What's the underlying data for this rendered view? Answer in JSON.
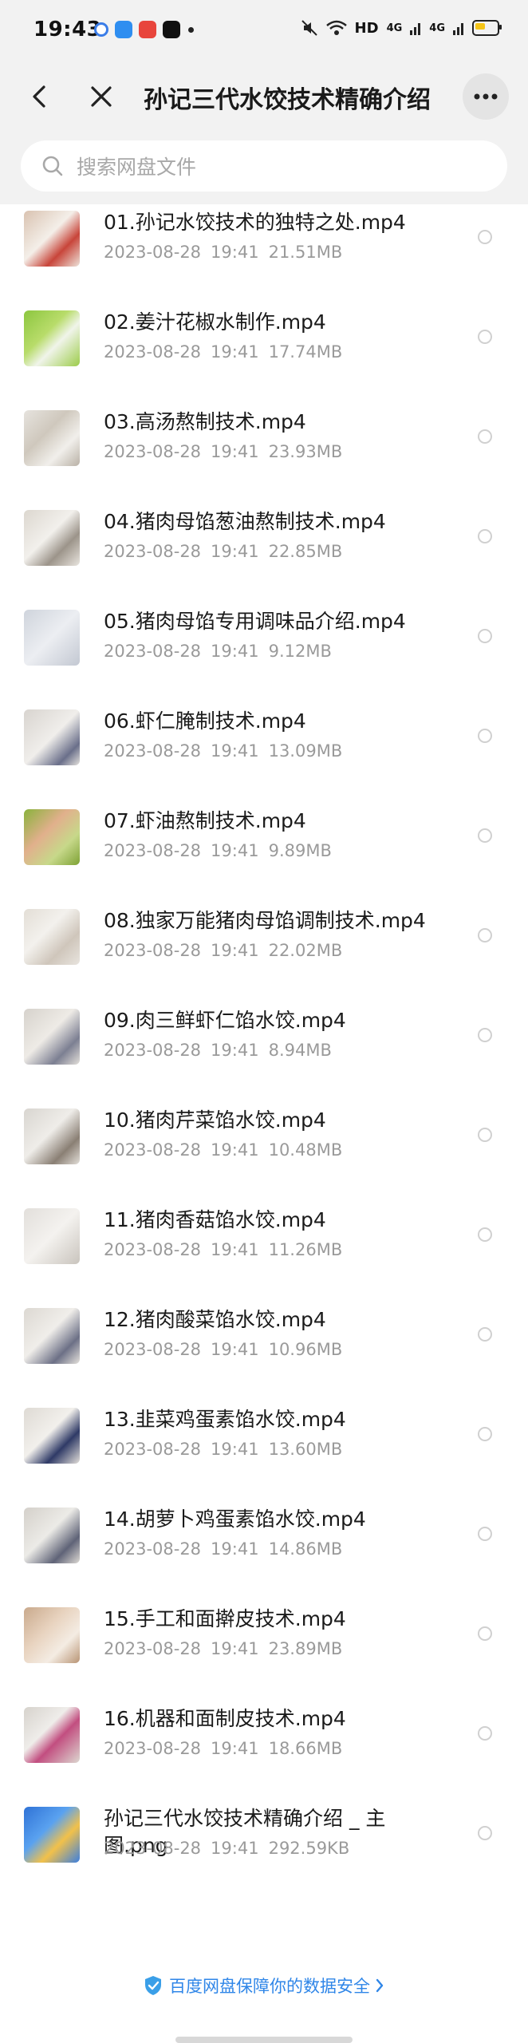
{
  "status_bar": {
    "time": "19:43",
    "network_label": "HD",
    "signal_1": "4G",
    "signal_2": "4G"
  },
  "nav": {
    "title": "孙记三代水饺技术精确介绍"
  },
  "search": {
    "placeholder": "搜索网盘文件"
  },
  "files": [
    {
      "name": "01.孙记水饺技术的独特之处.mp4",
      "date": "2023-08-28",
      "time": "19:41",
      "size": "21.51MB"
    },
    {
      "name": "02.姜汁花椒水制作.mp4",
      "date": "2023-08-28",
      "time": "19:41",
      "size": "17.74MB"
    },
    {
      "name": "03.高汤熬制技术.mp4",
      "date": "2023-08-28",
      "time": "19:41",
      "size": "23.93MB"
    },
    {
      "name": "04.猪肉母馅葱油熬制技术.mp4",
      "date": "2023-08-28",
      "time": "19:41",
      "size": "22.85MB"
    },
    {
      "name": "05.猪肉母馅专用调味品介绍.mp4",
      "date": "2023-08-28",
      "time": "19:41",
      "size": "9.12MB"
    },
    {
      "name": "06.虾仁腌制技术.mp4",
      "date": "2023-08-28",
      "time": "19:41",
      "size": "13.09MB"
    },
    {
      "name": "07.虾油熬制技术.mp4",
      "date": "2023-08-28",
      "time": "19:41",
      "size": "9.89MB"
    },
    {
      "name": "08.独家万能猪肉母馅调制技术.mp4",
      "date": "2023-08-28",
      "time": "19:41",
      "size": "22.02MB"
    },
    {
      "name": "09.肉三鲜虾仁馅水饺.mp4",
      "date": "2023-08-28",
      "time": "19:41",
      "size": "8.94MB"
    },
    {
      "name": "10.猪肉芹菜馅水饺.mp4",
      "date": "2023-08-28",
      "time": "19:41",
      "size": "10.48MB"
    },
    {
      "name": "11.猪肉香菇馅水饺.mp4",
      "date": "2023-08-28",
      "time": "19:41",
      "size": "11.26MB"
    },
    {
      "name": "12.猪肉酸菜馅水饺.mp4",
      "date": "2023-08-28",
      "time": "19:41",
      "size": "10.96MB"
    },
    {
      "name": "13.韭菜鸡蛋素馅水饺.mp4",
      "date": "2023-08-28",
      "time": "19:41",
      "size": "13.60MB"
    },
    {
      "name": "14.胡萝卜鸡蛋素馅水饺.mp4",
      "date": "2023-08-28",
      "time": "19:41",
      "size": "14.86MB"
    },
    {
      "name": "15.手工和面擀皮技术.mp4",
      "date": "2023-08-28",
      "time": "19:41",
      "size": "23.89MB"
    },
    {
      "name": "16.机器和面制皮技术.mp4",
      "date": "2023-08-28",
      "time": "19:41",
      "size": "18.66MB"
    },
    {
      "name": "孙记三代水饺技术精确介绍 _ 主图.png",
      "date": "2023-08-28",
      "time": "19:41",
      "size": "292.59KB"
    }
  ],
  "footer": {
    "text": "百度网盘保障你的数据安全"
  },
  "colors": {
    "accent": "#2f86e8",
    "background_header": "#f2f2f2",
    "meta_text": "#9a9a9a"
  }
}
